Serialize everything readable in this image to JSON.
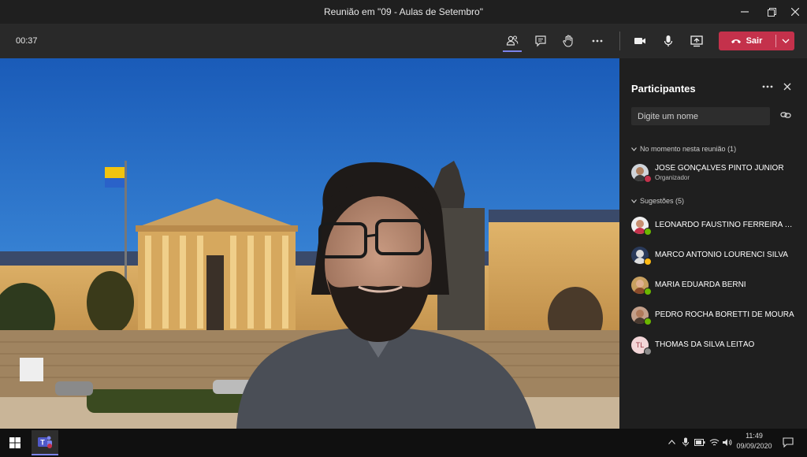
{
  "window": {
    "title": "Reunião em \"09 - Aulas de Setembro\""
  },
  "toolbar": {
    "timer": "00:37",
    "icons": [
      "participants-icon",
      "chat-icon",
      "raise-hand-icon",
      "more-icon",
      "camera-icon",
      "microphone-icon",
      "share-screen-icon"
    ],
    "leave_label": "Sair",
    "leave_color": "#c4314b",
    "accent_color": "#7b83eb"
  },
  "panel": {
    "title": "Participantes",
    "search_placeholder": "Digite um nome",
    "in_meeting_label": "No momento nesta reunião (1)",
    "in_meeting": [
      {
        "name": "JOSÉ GONÇALVES PINTO JÚNIOR",
        "role": "Organizador",
        "status": "busy"
      }
    ],
    "suggestions_label": "Sugestões (5)",
    "suggestions": [
      {
        "name": "LEONARDO FAUSTINO FERREIRA DA...",
        "status": "available"
      },
      {
        "name": "MARCO ANTONIO LOURENCI SILVA",
        "status": "away"
      },
      {
        "name": "MARIA EDUARDA BERNI",
        "status": "available"
      },
      {
        "name": "PEDRO ROCHA BORETTI DE MOURA",
        "status": "available"
      },
      {
        "name": "THOMAS DA SILVA LEITÃO",
        "initials": "TL",
        "status": "offline"
      }
    ]
  },
  "taskbar": {
    "time": "11:49",
    "date": "09/09/2020"
  }
}
